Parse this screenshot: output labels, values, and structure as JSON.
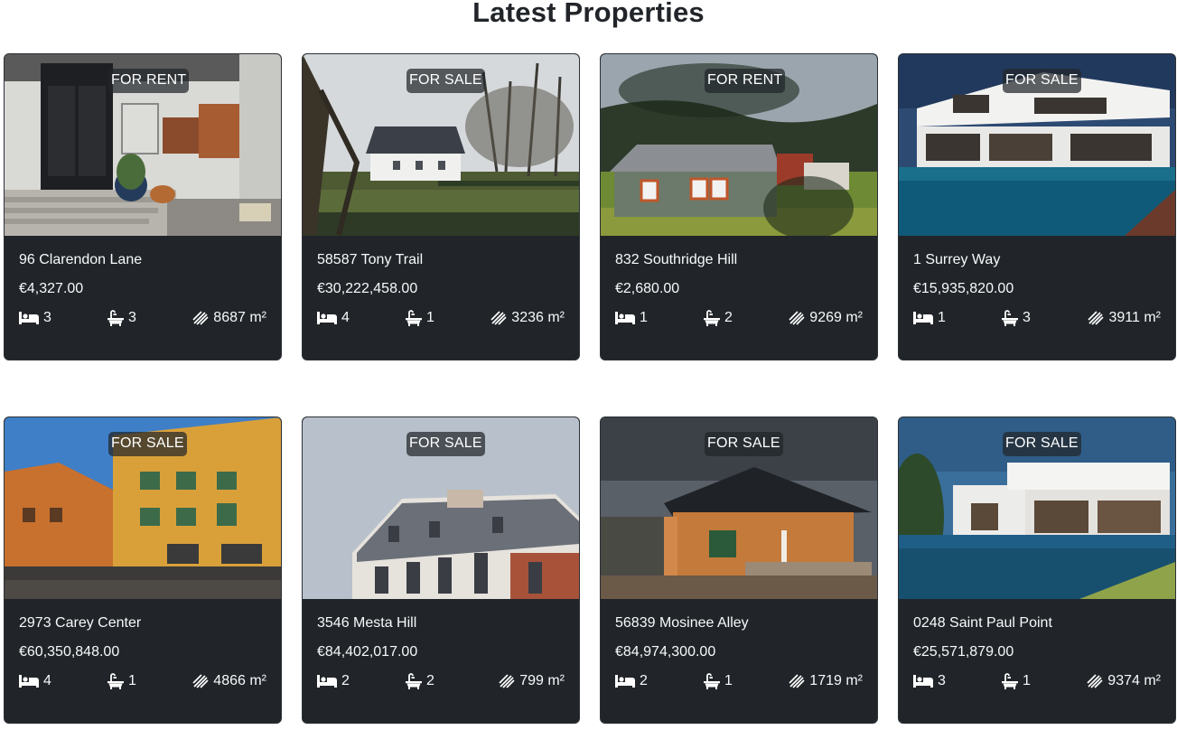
{
  "page": {
    "title": "Latest Properties"
  },
  "properties": [
    {
      "status": "FOR RENT",
      "address": "96 Clarendon Lane",
      "price": "€4,327.00",
      "beds": "3",
      "baths": "3",
      "area": "8687 m²",
      "scene": "house-door"
    },
    {
      "status": "FOR SALE",
      "address": "58587 Tony Trail",
      "price": "€30,222,458.00",
      "beds": "4",
      "baths": "1",
      "area": "3236 m²",
      "scene": "country-house"
    },
    {
      "status": "FOR RENT",
      "address": "832 Southridge Hill",
      "price": "€2,680.00",
      "beds": "1",
      "baths": "2",
      "area": "9269 m²",
      "scene": "wood-cabin"
    },
    {
      "status": "FOR SALE",
      "address": "1 Surrey Way",
      "price": "€15,935,820.00",
      "beds": "1",
      "baths": "3",
      "area": "3911 m²",
      "scene": "modern-villa"
    },
    {
      "status": "FOR SALE",
      "address": "2973 Carey Center",
      "price": "€60,350,848.00",
      "beds": "4",
      "baths": "1",
      "area": "4866 m²",
      "scene": "yellow-building"
    },
    {
      "status": "FOR SALE",
      "address": "3546 Mesta Hill",
      "price": "€84,402,017.00",
      "beds": "2",
      "baths": "2",
      "area": "799 m²",
      "scene": "paris-building"
    },
    {
      "status": "FOR SALE",
      "address": "56839 Mosinee Alley",
      "price": "€84,974,300.00",
      "beds": "2",
      "baths": "1",
      "area": "1719 m²",
      "scene": "timber-house"
    },
    {
      "status": "FOR SALE",
      "address": "0248 Saint Paul Point",
      "price": "€25,571,879.00",
      "beds": "3",
      "baths": "1",
      "area": "9374 m²",
      "scene": "white-villa-pool"
    }
  ],
  "icons": {
    "beds": "bed-icon",
    "baths": "bath-icon",
    "area": "ruler-area-icon"
  },
  "colors": {
    "card_bg": "#212529",
    "badge_bg": "#3d4146",
    "text": "#ffffff"
  }
}
